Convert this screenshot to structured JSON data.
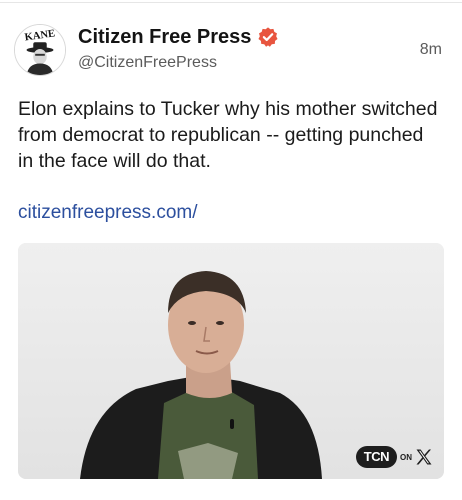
{
  "post": {
    "author": {
      "display_name": "Citizen Free Press",
      "handle": "@CitizenFreePress",
      "verified": true,
      "avatar_text": "KANE",
      "avatar_icon": "kane-hat-man-avatar"
    },
    "timestamp": "8m",
    "text": "Elon explains to Tucker why his mother switched from democrat to republican -- getting punched in the face will do that.",
    "link": "citizenfreepress.com/",
    "media": {
      "type": "video-thumbnail",
      "watermark": {
        "badge": "TCN",
        "on": "ON",
        "icon": "x-logo-icon"
      }
    }
  },
  "colors": {
    "verified_badge": "#e8553f",
    "link": "#2c4f9e",
    "text": "#1b1b1b",
    "muted": "#5b5b5b"
  }
}
